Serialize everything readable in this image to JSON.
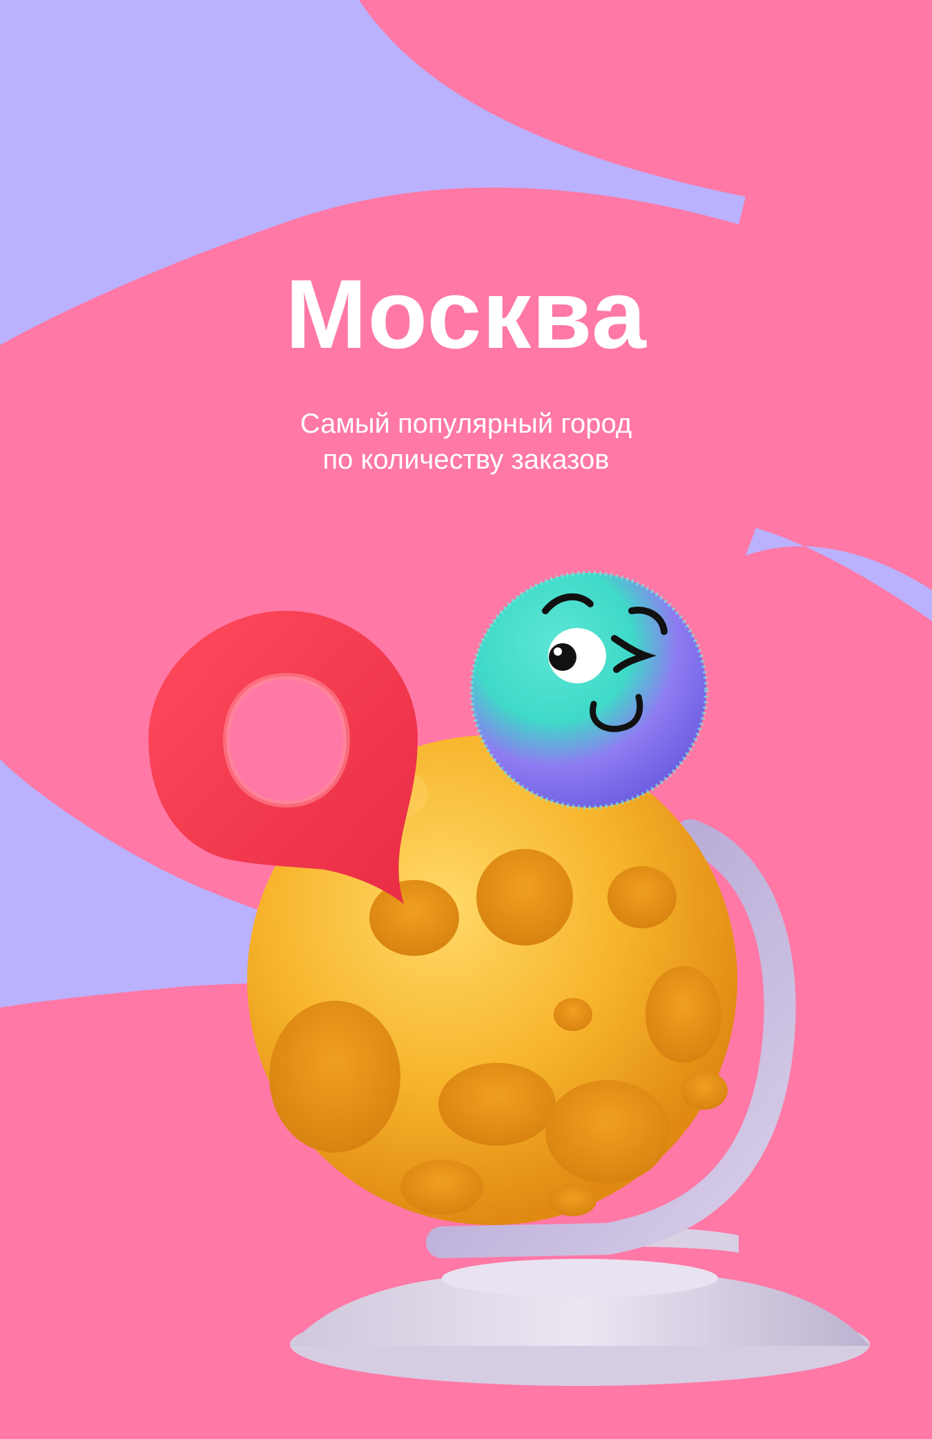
{
  "hero": {
    "title": "Москва",
    "subtitle_line1": "Самый популярный город",
    "subtitle_line2": "по количеству заказов"
  },
  "colors": {
    "background_pink": "#ff78a6",
    "blob_lavender": "#bab1ff",
    "text": "#ffffff",
    "pin_red": "#f2374e",
    "cheese_yellow": "#f7b52c",
    "fluff_teal": "#3fd9c8",
    "fluff_violet": "#8f7bf2",
    "stand_lilac": "#d9cfe8"
  },
  "illustration": {
    "icons": [
      "map-pin-icon",
      "cheese-globe",
      "fluffy-ball-mascot"
    ]
  }
}
